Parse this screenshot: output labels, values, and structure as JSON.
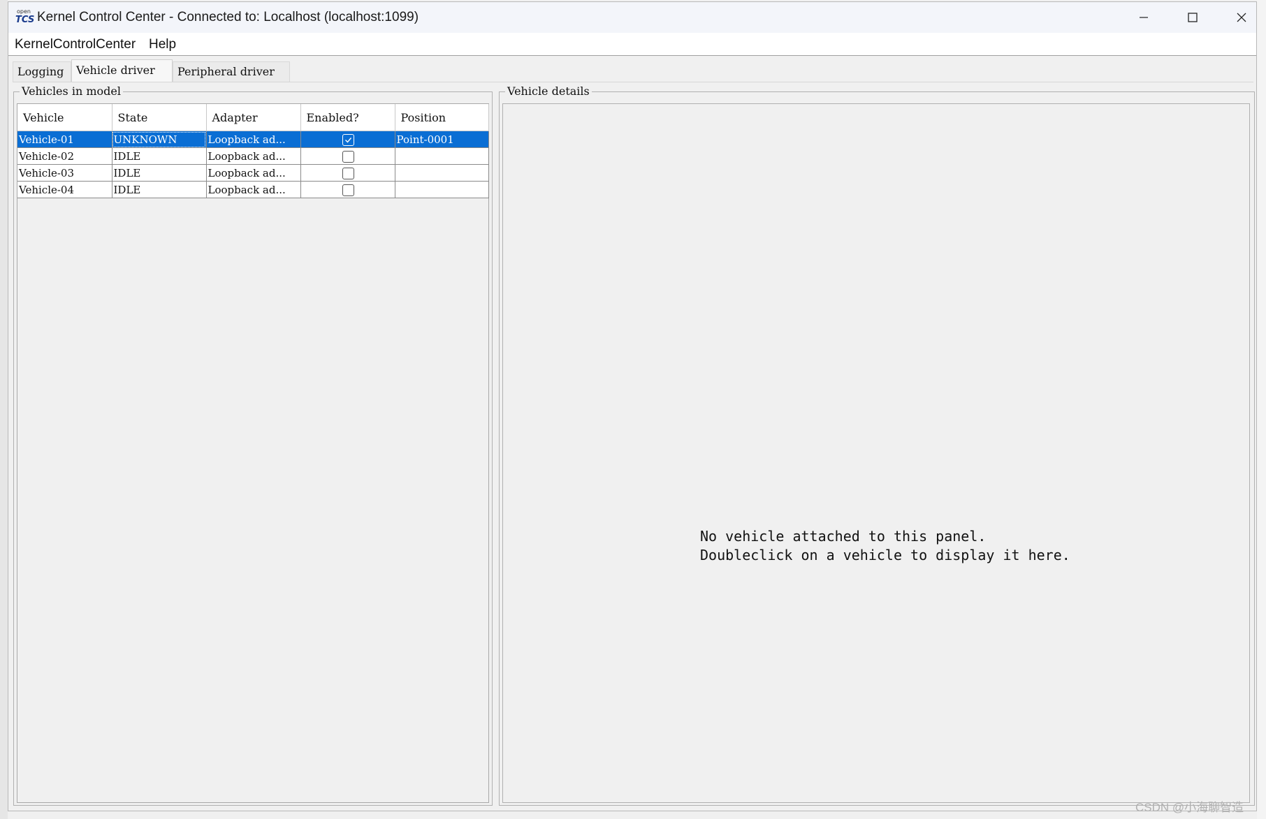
{
  "window": {
    "app_logo_top": "open",
    "app_logo_bottom": "TCS",
    "title": "Kernel Control Center - Connected to: Localhost (localhost:1099)"
  },
  "menu": {
    "items": [
      "KernelControlCenter",
      "Help"
    ]
  },
  "tabs": [
    {
      "label": "Logging",
      "active": false
    },
    {
      "label": "Vehicle driver",
      "active": true
    },
    {
      "label": "Peripheral driver",
      "active": false
    }
  ],
  "vehicles_panel": {
    "title": "Vehicles in model",
    "columns": [
      "Vehicle",
      "State",
      "Adapter",
      "Enabled?",
      "Position"
    ],
    "rows": [
      {
        "vehicle": "Vehicle-01",
        "state": "UNKNOWN",
        "adapter": "Loopback ad...",
        "enabled": true,
        "position": "Point-0001",
        "selected": true
      },
      {
        "vehicle": "Vehicle-02",
        "state": "IDLE",
        "adapter": "Loopback ad...",
        "enabled": false,
        "position": "",
        "selected": false
      },
      {
        "vehicle": "Vehicle-03",
        "state": "IDLE",
        "adapter": "Loopback ad...",
        "enabled": false,
        "position": "",
        "selected": false
      },
      {
        "vehicle": "Vehicle-04",
        "state": "IDLE",
        "adapter": "Loopback ad...",
        "enabled": false,
        "position": "",
        "selected": false
      }
    ]
  },
  "details_panel": {
    "title": "Vehicle details",
    "message_line1": "No vehicle attached to this panel.",
    "message_line2": "Doubleclick on a vehicle to display it here."
  },
  "watermark": "CSDN @小海聊智造",
  "colors": {
    "selection": "#0a6ed4",
    "background": "#f0f0f0"
  }
}
